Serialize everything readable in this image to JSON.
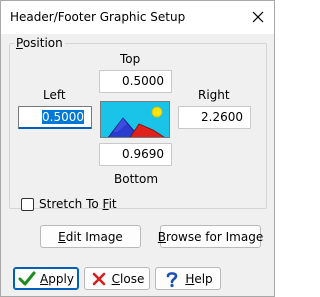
{
  "window": {
    "title": "Header/Footer Graphic Setup"
  },
  "position_group": {
    "label_prefix": "",
    "label_underlined": "P",
    "label_rest": "osition"
  },
  "fields": {
    "top": {
      "label": "Top",
      "value": "0.5000"
    },
    "left": {
      "label": "Left",
      "value": "0.5000"
    },
    "right": {
      "label": "Right",
      "value": "2.2600"
    },
    "bottom": {
      "label": "Bottom",
      "value": "0.9690"
    }
  },
  "stretch": {
    "label_before": "Stretch To ",
    "label_underlined": "F",
    "label_after": "it",
    "checked": false
  },
  "buttons": {
    "edit_image": {
      "before": "",
      "underlined": "E",
      "after": "dit Image"
    },
    "browse_image": {
      "before": "",
      "underlined": "B",
      "after": "rowse for Image"
    },
    "apply": {
      "before": "",
      "underlined": "A",
      "after": "pply"
    },
    "close": {
      "before": "",
      "underlined": "C",
      "after": "lose"
    },
    "help": {
      "before": "",
      "underlined": "H",
      "after": "elp"
    }
  },
  "icons": {
    "close_window": "close-icon",
    "apply": "checkmark-icon",
    "close": "x-icon",
    "help": "question-mark-icon",
    "preview": "landscape-image-icon"
  },
  "colors": {
    "focus_blue": "#005fb8",
    "selection_blue": "#0078d7",
    "check_green": "#1f8a1f",
    "x_red": "#d42020",
    "help_blue": "#1b4fb3"
  }
}
